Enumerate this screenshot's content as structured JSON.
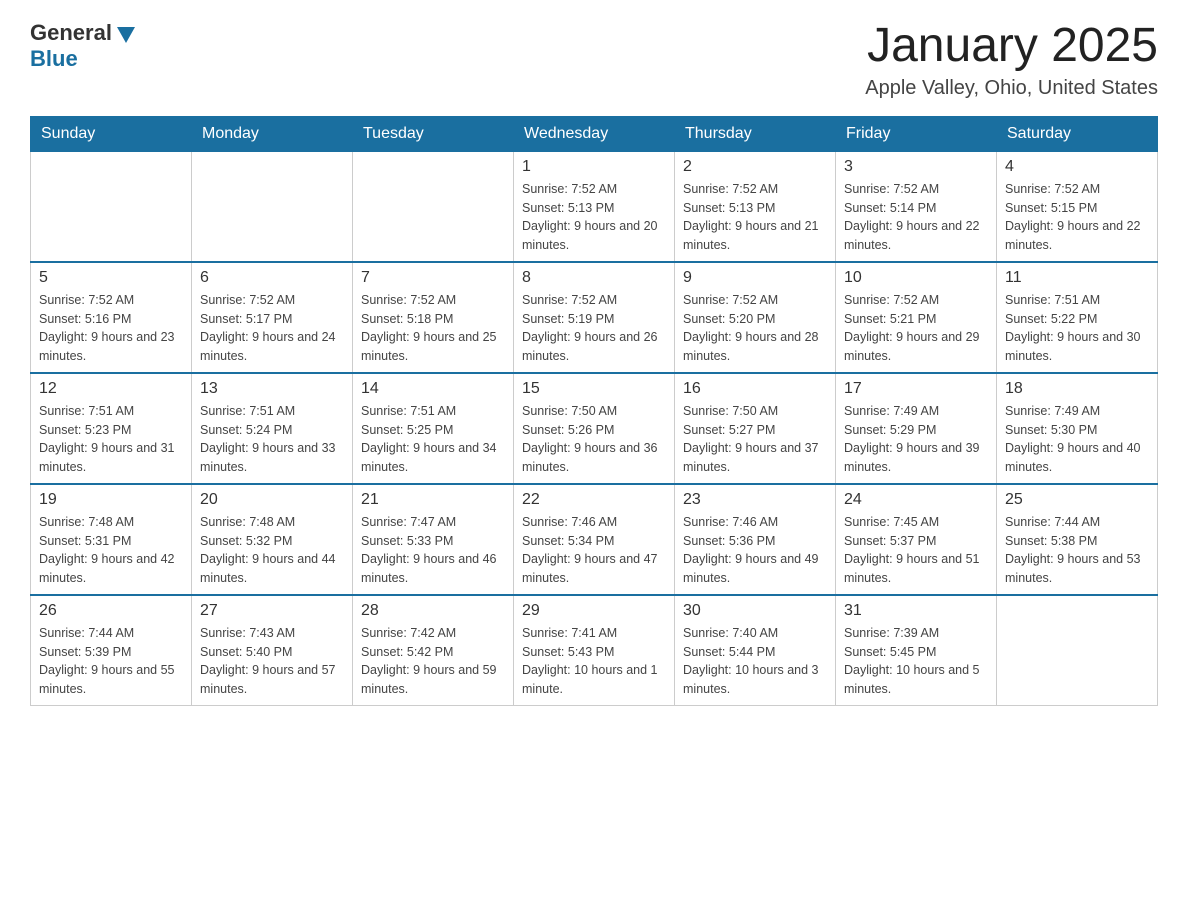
{
  "logo": {
    "general": "General",
    "triangle": "▶",
    "blue": "Blue"
  },
  "title": "January 2025",
  "location": "Apple Valley, Ohio, United States",
  "headers": [
    "Sunday",
    "Monday",
    "Tuesday",
    "Wednesday",
    "Thursday",
    "Friday",
    "Saturday"
  ],
  "weeks": [
    [
      {
        "day": "",
        "info": ""
      },
      {
        "day": "",
        "info": ""
      },
      {
        "day": "",
        "info": ""
      },
      {
        "day": "1",
        "info": "Sunrise: 7:52 AM\nSunset: 5:13 PM\nDaylight: 9 hours and 20 minutes."
      },
      {
        "day": "2",
        "info": "Sunrise: 7:52 AM\nSunset: 5:13 PM\nDaylight: 9 hours and 21 minutes."
      },
      {
        "day": "3",
        "info": "Sunrise: 7:52 AM\nSunset: 5:14 PM\nDaylight: 9 hours and 22 minutes."
      },
      {
        "day": "4",
        "info": "Sunrise: 7:52 AM\nSunset: 5:15 PM\nDaylight: 9 hours and 22 minutes."
      }
    ],
    [
      {
        "day": "5",
        "info": "Sunrise: 7:52 AM\nSunset: 5:16 PM\nDaylight: 9 hours and 23 minutes."
      },
      {
        "day": "6",
        "info": "Sunrise: 7:52 AM\nSunset: 5:17 PM\nDaylight: 9 hours and 24 minutes."
      },
      {
        "day": "7",
        "info": "Sunrise: 7:52 AM\nSunset: 5:18 PM\nDaylight: 9 hours and 25 minutes."
      },
      {
        "day": "8",
        "info": "Sunrise: 7:52 AM\nSunset: 5:19 PM\nDaylight: 9 hours and 26 minutes."
      },
      {
        "day": "9",
        "info": "Sunrise: 7:52 AM\nSunset: 5:20 PM\nDaylight: 9 hours and 28 minutes."
      },
      {
        "day": "10",
        "info": "Sunrise: 7:52 AM\nSunset: 5:21 PM\nDaylight: 9 hours and 29 minutes."
      },
      {
        "day": "11",
        "info": "Sunrise: 7:51 AM\nSunset: 5:22 PM\nDaylight: 9 hours and 30 minutes."
      }
    ],
    [
      {
        "day": "12",
        "info": "Sunrise: 7:51 AM\nSunset: 5:23 PM\nDaylight: 9 hours and 31 minutes."
      },
      {
        "day": "13",
        "info": "Sunrise: 7:51 AM\nSunset: 5:24 PM\nDaylight: 9 hours and 33 minutes."
      },
      {
        "day": "14",
        "info": "Sunrise: 7:51 AM\nSunset: 5:25 PM\nDaylight: 9 hours and 34 minutes."
      },
      {
        "day": "15",
        "info": "Sunrise: 7:50 AM\nSunset: 5:26 PM\nDaylight: 9 hours and 36 minutes."
      },
      {
        "day": "16",
        "info": "Sunrise: 7:50 AM\nSunset: 5:27 PM\nDaylight: 9 hours and 37 minutes."
      },
      {
        "day": "17",
        "info": "Sunrise: 7:49 AM\nSunset: 5:29 PM\nDaylight: 9 hours and 39 minutes."
      },
      {
        "day": "18",
        "info": "Sunrise: 7:49 AM\nSunset: 5:30 PM\nDaylight: 9 hours and 40 minutes."
      }
    ],
    [
      {
        "day": "19",
        "info": "Sunrise: 7:48 AM\nSunset: 5:31 PM\nDaylight: 9 hours and 42 minutes."
      },
      {
        "day": "20",
        "info": "Sunrise: 7:48 AM\nSunset: 5:32 PM\nDaylight: 9 hours and 44 minutes."
      },
      {
        "day": "21",
        "info": "Sunrise: 7:47 AM\nSunset: 5:33 PM\nDaylight: 9 hours and 46 minutes."
      },
      {
        "day": "22",
        "info": "Sunrise: 7:46 AM\nSunset: 5:34 PM\nDaylight: 9 hours and 47 minutes."
      },
      {
        "day": "23",
        "info": "Sunrise: 7:46 AM\nSunset: 5:36 PM\nDaylight: 9 hours and 49 minutes."
      },
      {
        "day": "24",
        "info": "Sunrise: 7:45 AM\nSunset: 5:37 PM\nDaylight: 9 hours and 51 minutes."
      },
      {
        "day": "25",
        "info": "Sunrise: 7:44 AM\nSunset: 5:38 PM\nDaylight: 9 hours and 53 minutes."
      }
    ],
    [
      {
        "day": "26",
        "info": "Sunrise: 7:44 AM\nSunset: 5:39 PM\nDaylight: 9 hours and 55 minutes."
      },
      {
        "day": "27",
        "info": "Sunrise: 7:43 AM\nSunset: 5:40 PM\nDaylight: 9 hours and 57 minutes."
      },
      {
        "day": "28",
        "info": "Sunrise: 7:42 AM\nSunset: 5:42 PM\nDaylight: 9 hours and 59 minutes."
      },
      {
        "day": "29",
        "info": "Sunrise: 7:41 AM\nSunset: 5:43 PM\nDaylight: 10 hours and 1 minute."
      },
      {
        "day": "30",
        "info": "Sunrise: 7:40 AM\nSunset: 5:44 PM\nDaylight: 10 hours and 3 minutes."
      },
      {
        "day": "31",
        "info": "Sunrise: 7:39 AM\nSunset: 5:45 PM\nDaylight: 10 hours and 5 minutes."
      },
      {
        "day": "",
        "info": ""
      }
    ]
  ]
}
